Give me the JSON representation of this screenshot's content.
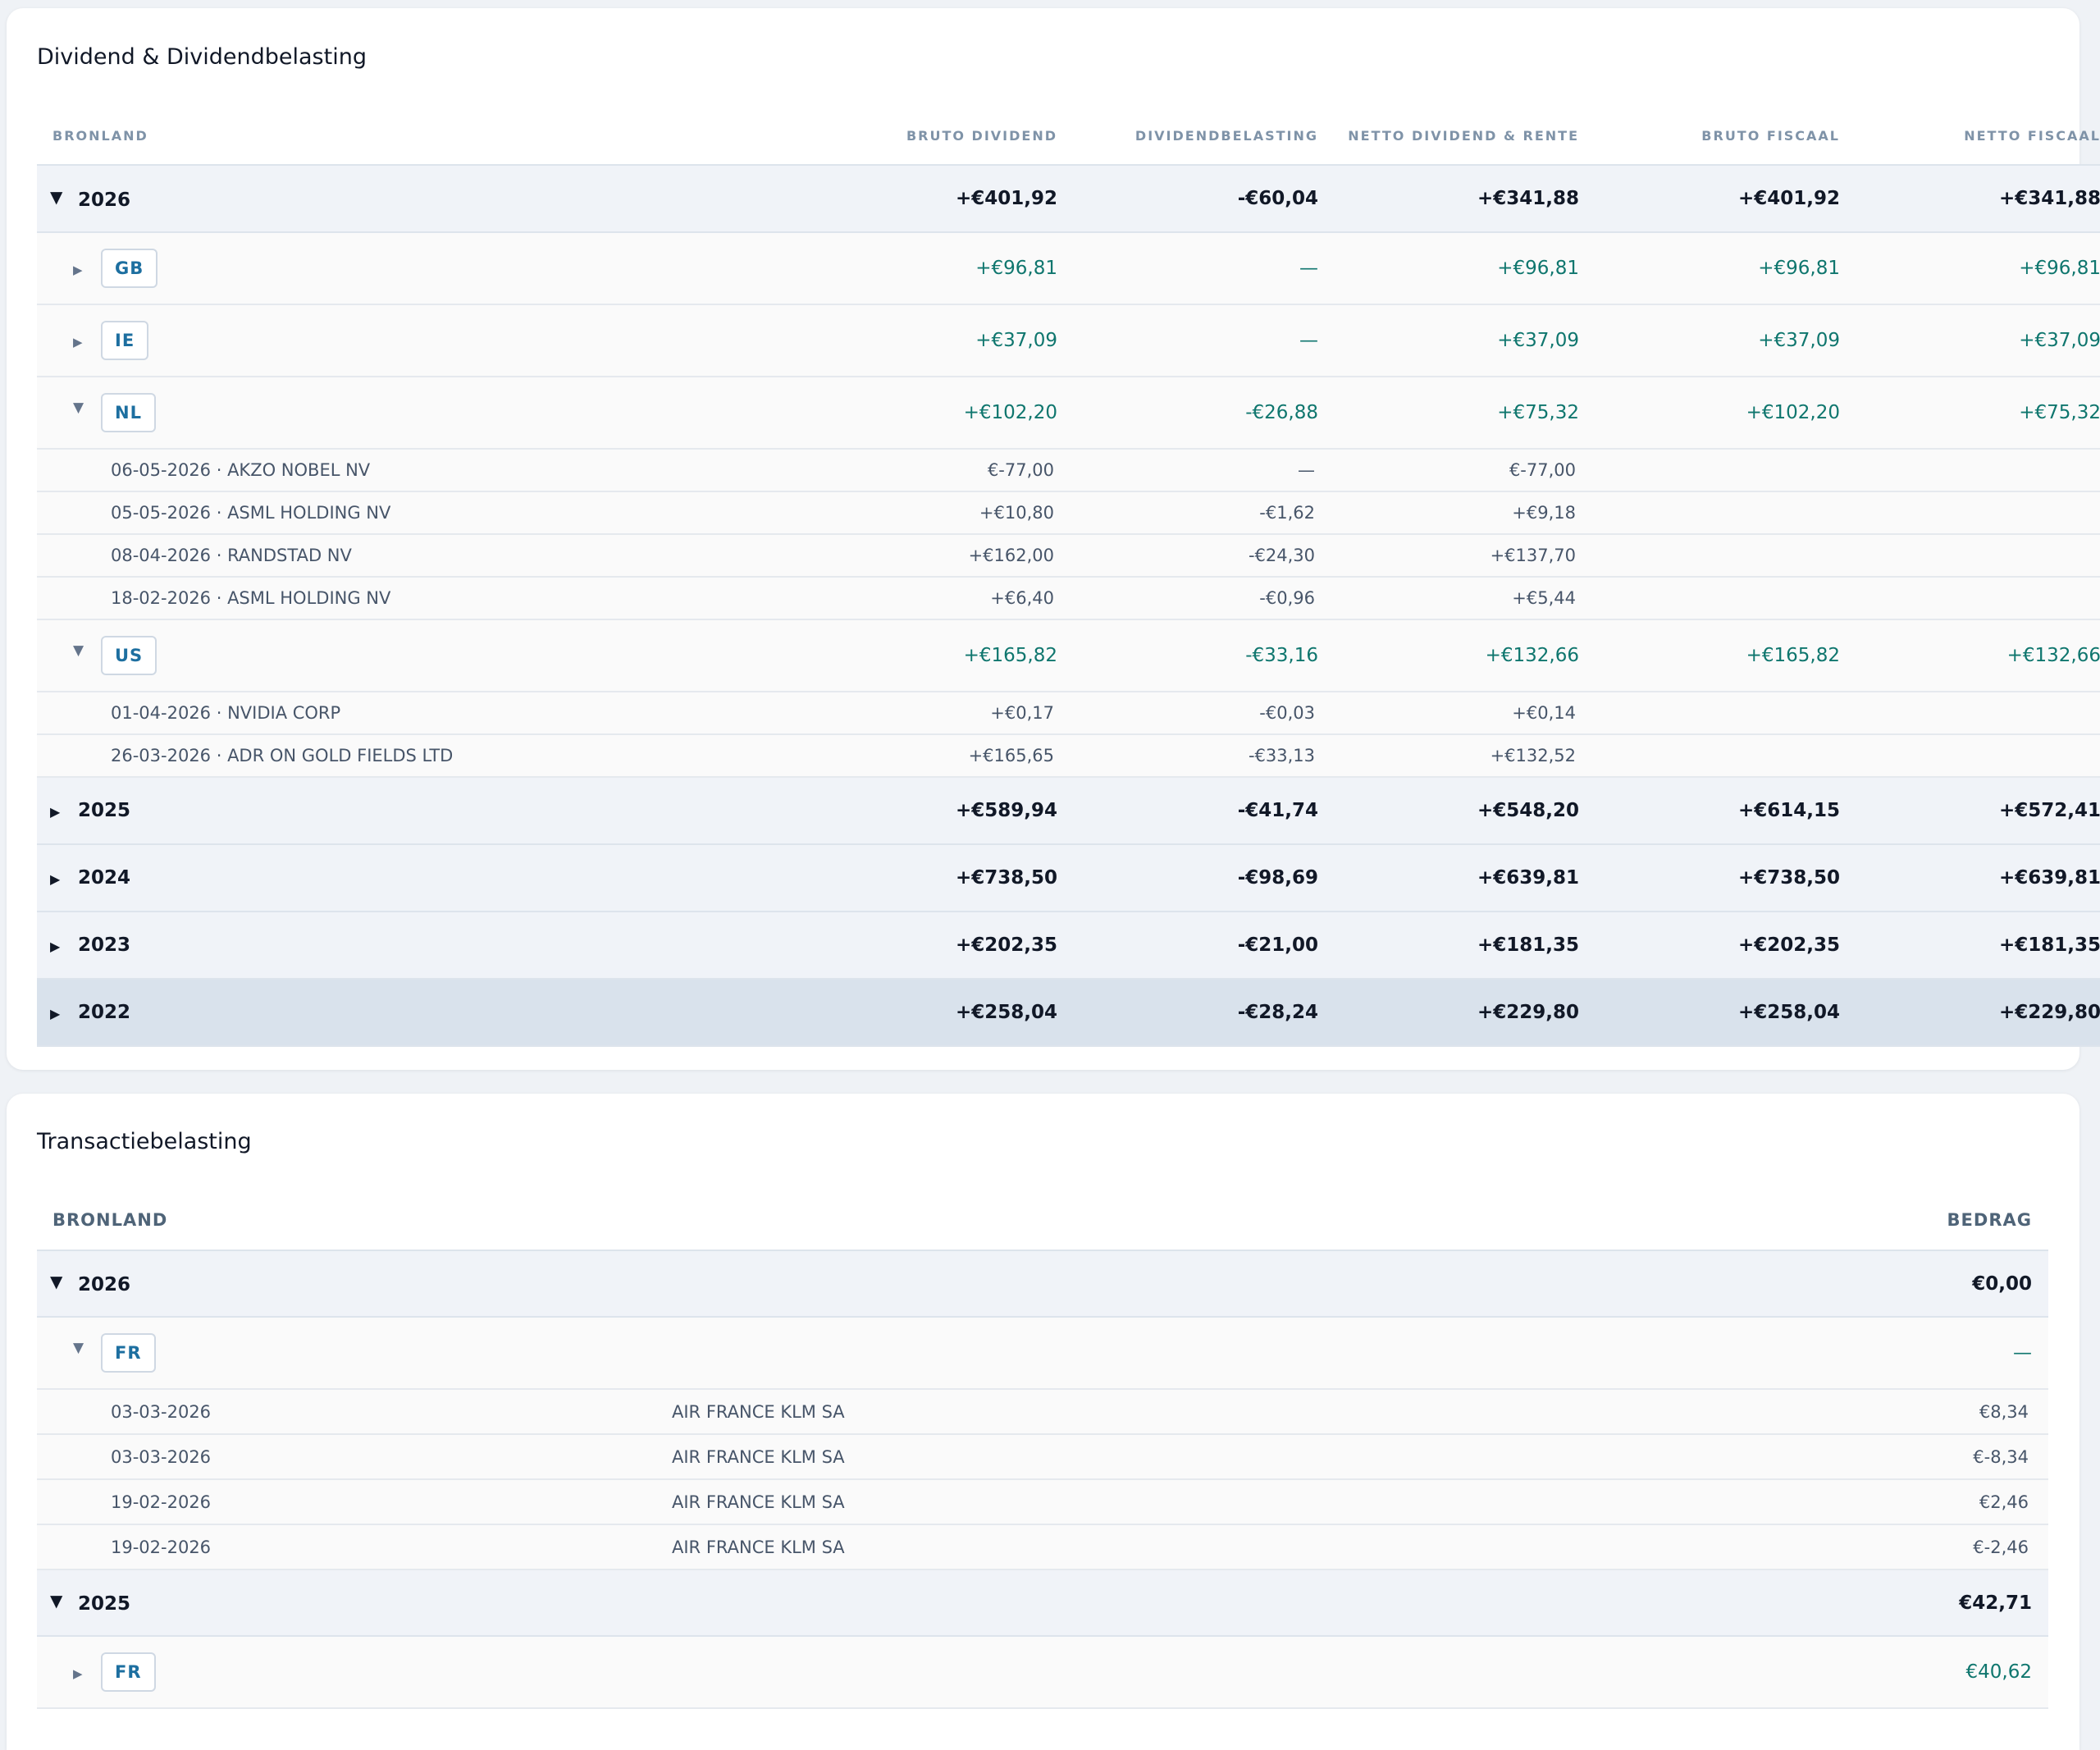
{
  "dividend": {
    "title": "Dividend & Dividendbelasting",
    "columns": [
      "BRONLAND",
      "BRUTO DIVIDEND",
      "DIVIDENDBELASTING",
      "NETTO DIVIDEND & RENTE",
      "BRUTO FISCAAL",
      "NETTO FISCAAL"
    ],
    "y2026": {
      "year": "2026",
      "values": [
        "+€401,92",
        "-€60,04",
        "+€341,88",
        "+€401,92",
        "+€341,88"
      ],
      "gb": {
        "code": "GB",
        "values": [
          "+€96,81",
          "—",
          "+€96,81",
          "+€96,81",
          "+€96,81"
        ]
      },
      "ie": {
        "code": "IE",
        "values": [
          "+€37,09",
          "—",
          "+€37,09",
          "+€37,09",
          "+€37,09"
        ]
      },
      "nl": {
        "code": "NL",
        "values": [
          "+€102,20",
          "-€26,88",
          "+€75,32",
          "+€102,20",
          "+€75,32"
        ],
        "rows": [
          {
            "label": "06-05-2026 · AKZO NOBEL NV",
            "values": [
              "€-77,00",
              "—",
              "€-77,00"
            ]
          },
          {
            "label": "05-05-2026 · ASML HOLDING NV",
            "values": [
              "+€10,80",
              "-€1,62",
              "+€9,18"
            ]
          },
          {
            "label": "08-04-2026 · RANDSTAD NV",
            "values": [
              "+€162,00",
              "-€24,30",
              "+€137,70"
            ]
          },
          {
            "label": "18-02-2026 · ASML HOLDING NV",
            "values": [
              "+€6,40",
              "-€0,96",
              "+€5,44"
            ]
          }
        ]
      },
      "us": {
        "code": "US",
        "values": [
          "+€165,82",
          "-€33,16",
          "+€132,66",
          "+€165,82",
          "+€132,66"
        ],
        "rows": [
          {
            "label": "01-04-2026 · NVIDIA CORP",
            "values": [
              "+€0,17",
              "-€0,03",
              "+€0,14"
            ]
          },
          {
            "label": "26-03-2026 · ADR ON GOLD FIELDS LTD",
            "values": [
              "+€165,65",
              "-€33,13",
              "+€132,52"
            ]
          }
        ]
      }
    },
    "years": [
      {
        "year": "2025",
        "values": [
          "+€589,94",
          "-€41,74",
          "+€548,20",
          "+€614,15",
          "+€572,41"
        ]
      },
      {
        "year": "2024",
        "values": [
          "+€738,50",
          "-€98,69",
          "+€639,81",
          "+€738,50",
          "+€639,81"
        ]
      },
      {
        "year": "2023",
        "values": [
          "+€202,35",
          "-€21,00",
          "+€181,35",
          "+€202,35",
          "+€181,35"
        ]
      },
      {
        "year": "2022",
        "values": [
          "+€258,04",
          "-€28,24",
          "+€229,80",
          "+€258,04",
          "+€229,80"
        ]
      }
    ]
  },
  "transaction": {
    "title": "Transactiebelasting",
    "columns": [
      "BRONLAND",
      "BEDRAG"
    ],
    "y2026": {
      "year": "2026",
      "amount": "€0,00",
      "fr": {
        "code": "FR",
        "amount": "—",
        "rows": [
          {
            "date": "03-03-2026",
            "name": "AIR FRANCE KLM SA",
            "amount": "€8,34"
          },
          {
            "date": "03-03-2026",
            "name": "AIR FRANCE KLM SA",
            "amount": "€-8,34"
          },
          {
            "date": "19-02-2026",
            "name": "AIR FRANCE KLM SA",
            "amount": "€2,46"
          },
          {
            "date": "19-02-2026",
            "name": "AIR FRANCE KLM SA",
            "amount": "€-2,46"
          }
        ]
      }
    },
    "y2025": {
      "year": "2025",
      "amount": "€42,71",
      "fr": {
        "code": "FR",
        "amount": "€40,62"
      }
    }
  },
  "colors": {
    "positive": "#0f766e",
    "negative": "#dc2626",
    "badge_text": "#1d6fa0",
    "header": "#7f93a8"
  },
  "icons": {
    "expanded": "caret-down-icon",
    "collapsed": "caret-right-icon"
  }
}
